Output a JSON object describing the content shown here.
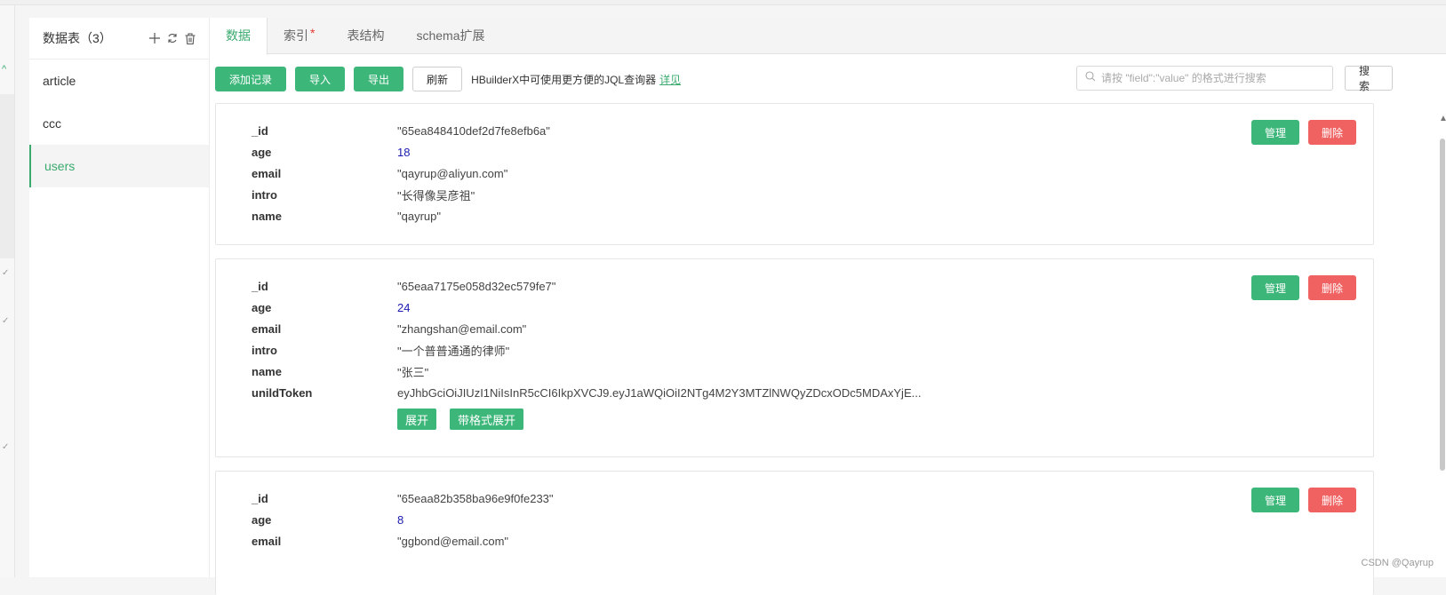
{
  "sidebar": {
    "title": "数据表（3）",
    "items": [
      {
        "label": "article"
      },
      {
        "label": "ccc"
      },
      {
        "label": "users"
      }
    ]
  },
  "tabs": [
    "数据",
    "索引",
    "表结构",
    "schema扩展"
  ],
  "toolbar": {
    "add": "添加记录",
    "import": "导入",
    "export": "导出",
    "refresh": "刷新",
    "tip": "HBuilderX中可使用更方便的JQL查询器",
    "tip_link": "详见",
    "search_placeholder": "请按 \"field\":\"value\" 的格式进行搜索",
    "search_btn": "搜索"
  },
  "record_actions": {
    "manage": "管理",
    "delete": "删除"
  },
  "expand_actions": {
    "expand": "展开",
    "expand_formatted": "带格式展开"
  },
  "records": [
    {
      "fields": [
        {
          "key": "_id",
          "value": "\"65ea848410def2d7fe8efb6a\""
        },
        {
          "key": "age",
          "value": "18"
        },
        {
          "key": "email",
          "value": "\"qayrup@aliyun.com\""
        },
        {
          "key": "intro",
          "value": "\"长得像吴彦祖\""
        },
        {
          "key": "name",
          "value": "\"qayrup\""
        }
      ]
    },
    {
      "fields": [
        {
          "key": "_id",
          "value": "\"65eaa7175e058d32ec579fe7\""
        },
        {
          "key": "age",
          "value": "24"
        },
        {
          "key": "email",
          "value": "\"zhangshan@email.com\""
        },
        {
          "key": "intro",
          "value": "\"一个普普通通的律师\""
        },
        {
          "key": "name",
          "value": "\"张三\""
        },
        {
          "key": "unildToken",
          "value": "eyJhbGciOiJIUzI1NiIsInR5cCI6IkpXVCJ9.eyJ1aWQiOiI2NTg4M2Y3MTZlNWQyZDcxODc5MDAxYjE..."
        }
      ]
    },
    {
      "fields": [
        {
          "key": "_id",
          "value": "\"65eaa82b358ba96e9f0fe233\""
        },
        {
          "key": "age",
          "value": "8"
        },
        {
          "key": "email",
          "value": "\"ggbond@email.com\""
        }
      ]
    }
  ],
  "watermark": "CSDN @Qayrup"
}
